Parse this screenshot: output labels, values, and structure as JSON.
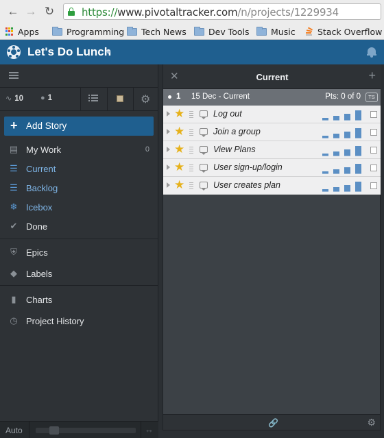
{
  "browser": {
    "url_protocol": "https://",
    "url_host": "www.pivotaltracker.com",
    "url_path": "/n/projects/1229934",
    "bookmarks": [
      {
        "label": "Apps",
        "icon": "apps-grid-icon"
      },
      {
        "label": "Programming",
        "icon": "folder-icon"
      },
      {
        "label": "Tech News",
        "icon": "folder-icon"
      },
      {
        "label": "Dev Tools",
        "icon": "folder-icon"
      },
      {
        "label": "Music",
        "icon": "folder-icon"
      },
      {
        "label": "Stack Overflow",
        "icon": "stack-overflow-icon"
      }
    ]
  },
  "app": {
    "project_title": "Let's Do Lunch",
    "brand_color": "#1f5f8f"
  },
  "sidebar": {
    "stats": {
      "velocity": "10",
      "members": "1"
    },
    "add_story_label": "Add Story",
    "nav": [
      {
        "label": "My Work",
        "icon": "inbox-icon",
        "count": "0"
      },
      {
        "label": "Current",
        "icon": "list-icon"
      },
      {
        "label": "Backlog",
        "icon": "list-icon"
      },
      {
        "label": "Icebox",
        "icon": "snowflake-icon"
      },
      {
        "label": "Done",
        "icon": "check-icon"
      },
      {
        "label": "Epics",
        "icon": "shield-icon"
      },
      {
        "label": "Labels",
        "icon": "tag-icon"
      },
      {
        "label": "Charts",
        "icon": "bar-chart-icon"
      },
      {
        "label": "Project History",
        "icon": "clock-icon"
      }
    ],
    "footer": {
      "auto_label": "Auto"
    }
  },
  "panel": {
    "title": "Current",
    "iteration": {
      "number": "1",
      "date_label": "15 Dec - Current",
      "points": "Pts: 0 of 0",
      "badge": "TS"
    },
    "stories": [
      {
        "title": "Log out",
        "estimate_points": 3
      },
      {
        "title": "Join a group",
        "estimate_points": 3
      },
      {
        "title": "View Plans",
        "estimate_points": 3
      },
      {
        "title": "User sign-up/login",
        "estimate_points": 3
      },
      {
        "title": "User creates plan",
        "estimate_points": 3
      }
    ]
  }
}
